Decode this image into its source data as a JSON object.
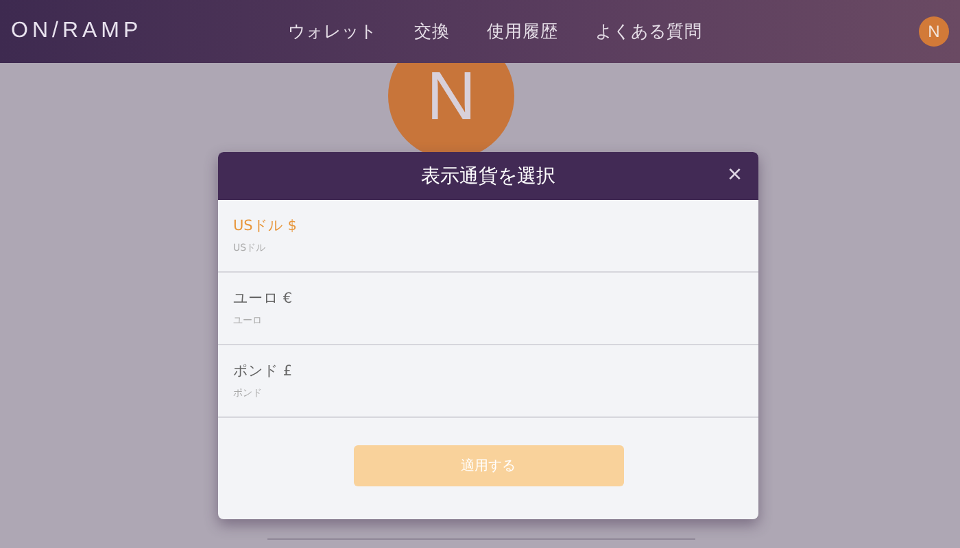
{
  "header": {
    "logo": "ON/RAMP",
    "nav": [
      {
        "label": "ウォレット"
      },
      {
        "label": "交換"
      },
      {
        "label": "使用履歴"
      },
      {
        "label": "よくある質問"
      }
    ],
    "user_initial": "N"
  },
  "profile": {
    "initial": "N"
  },
  "dialog": {
    "title": "表示通貨を選択",
    "close": "×",
    "options": [
      {
        "name": "USドル $",
        "subtitle": "USドル",
        "selected": true
      },
      {
        "name": "ユーロ €",
        "subtitle": "ユーロ",
        "selected": false
      },
      {
        "name": "ポンド £",
        "subtitle": "ポンド",
        "selected": false
      }
    ],
    "apply": {
      "label": "適用する",
      "disabled": true
    }
  }
}
